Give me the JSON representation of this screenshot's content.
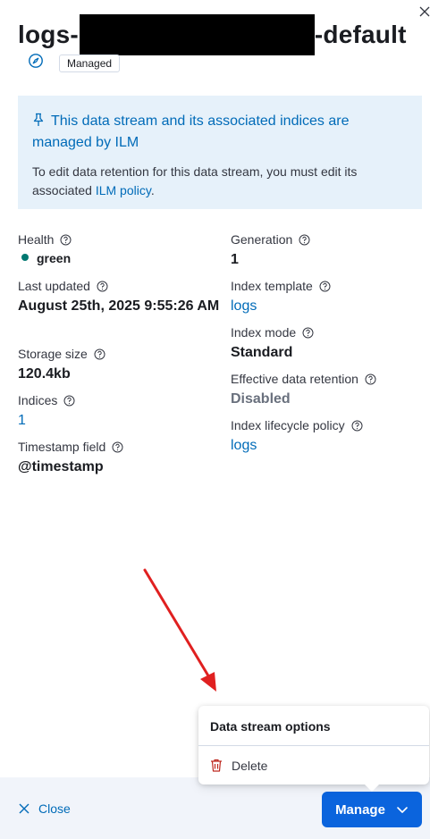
{
  "flyout": {
    "title_prefix": "logs-",
    "title_suffix": "-default",
    "badge": "Managed"
  },
  "callout": {
    "title": "This data stream and its associated indices are managed by ILM",
    "body_text": "To edit data retention for this data stream, you must edit its associated ",
    "body_link": "ILM policy",
    "body_end": "."
  },
  "details": {
    "left": [
      {
        "label": "Health",
        "value": "green"
      },
      {
        "label": "Last updated",
        "value": "August 25th, 2025 9:55:26 AM"
      },
      {
        "label": "Storage size",
        "value": "120.4kb"
      },
      {
        "label": "Indices",
        "value": "1"
      },
      {
        "label": "Timestamp field",
        "value": "@timestamp"
      }
    ],
    "right": [
      {
        "label": "Generation",
        "value": "1"
      },
      {
        "label": "Index template",
        "value": "logs"
      },
      {
        "label": "Index mode",
        "value": "Standard"
      },
      {
        "label": "Effective data retention",
        "value": "Disabled"
      },
      {
        "label": "Index lifecycle policy",
        "value": "logs"
      }
    ]
  },
  "popover": {
    "title": "Data stream options",
    "delete_label": "Delete"
  },
  "footer": {
    "close_label": "Close",
    "manage_label": "Manage"
  },
  "colors": {
    "link": "#006bb8",
    "primary_button": "#0b64dd",
    "health_green": "#007871",
    "callout_bg": "#e6f1fa",
    "annotation_arrow": "#e02020",
    "delete_icon": "#bd271e"
  }
}
